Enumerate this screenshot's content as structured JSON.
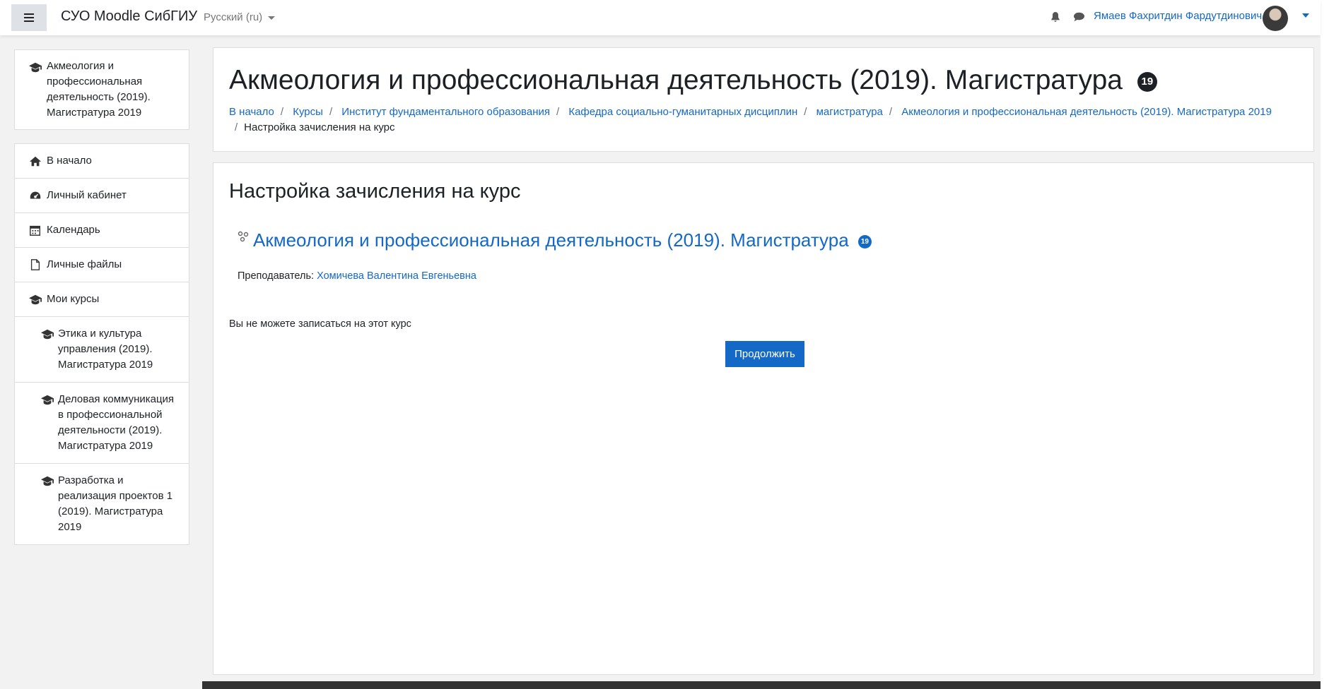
{
  "navbar": {
    "brand": "СУО Moodle СибГИУ",
    "language": "Русский (ru)",
    "user_name": "Ямаев Фахритдин Фардутдинович"
  },
  "sidebar": {
    "current_course": "Акмеология и профессиональная деятельность (2019). Магистратура 2019",
    "items": [
      {
        "label": "В начало",
        "icon": "home-icon"
      },
      {
        "label": "Личный кабинет",
        "icon": "dashboard-icon"
      },
      {
        "label": "Календарь",
        "icon": "calendar-icon"
      },
      {
        "label": "Личные файлы",
        "icon": "file-icon"
      },
      {
        "label": "Мои курсы",
        "icon": "graduation-cap-icon"
      }
    ],
    "courses": [
      "Этика и культура управления (2019). Магистратура 2019",
      "Деловая коммуникация в профессиональной деятельности (2019). Магистратура 2019",
      "Разработка и реализация проектов 1 (2019). Магистратура 2019"
    ]
  },
  "header": {
    "title": "Акмеология и профессиональная деятельность (2019). Магистратура",
    "age_badge": "19",
    "breadcrumb": [
      "В начало",
      "Курсы",
      "Институт фундаментального образования",
      "Кафедра социально-гуманитарных дисциплин",
      "магистратура",
      "Акмеология и профессиональная деятельность (2019). Магистратура 2019",
      "Настройка зачисления на курс"
    ]
  },
  "main": {
    "section_title": "Настройка зачисления на курс",
    "course_link": "Акмеология и профессиональная деятельность (2019). Магистратура",
    "course_badge": "19",
    "teacher_label": "Преподаватель:",
    "teacher_name": "Хомичева Валентина Евгеньевна",
    "message": "Вы не можете записаться на этот курс",
    "continue_button": "Продолжить"
  },
  "colors": {
    "link": "#1468c6",
    "button": "#1468c6",
    "background": "#f2f2f2"
  }
}
